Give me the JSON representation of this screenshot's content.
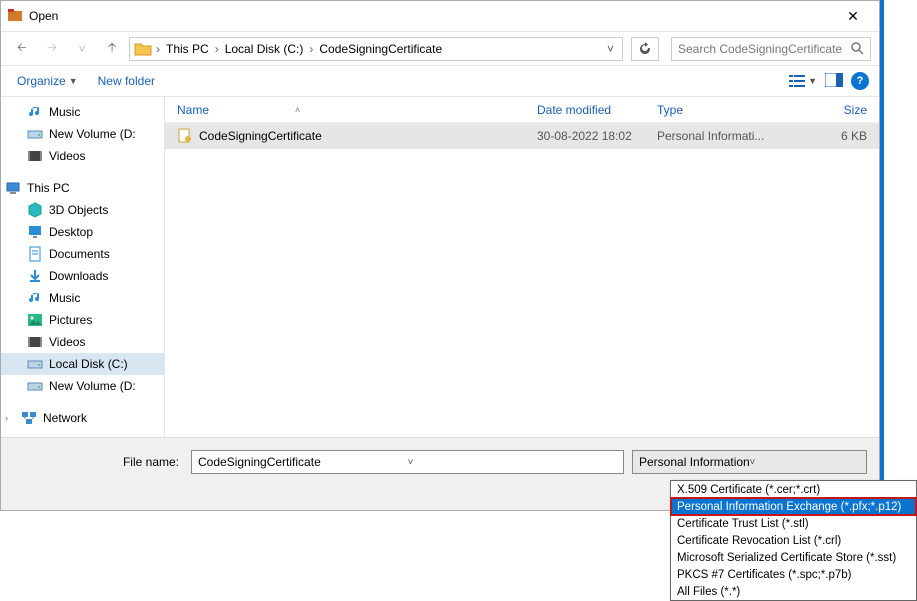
{
  "title": "Open",
  "breadcrumbs": [
    "This PC",
    "Local Disk (C:)",
    "CodeSigningCertificate"
  ],
  "search_placeholder": "Search CodeSigningCertificate",
  "toolbar": {
    "organize": "Organize",
    "new_folder": "New folder"
  },
  "tree": {
    "quick": [
      {
        "label": "Music",
        "icon": "music"
      },
      {
        "label": "New Volume (D:",
        "icon": "drive"
      },
      {
        "label": "Videos",
        "icon": "video"
      }
    ],
    "thispc_label": "This PC",
    "thispc": [
      {
        "label": "3D Objects",
        "icon": "cube"
      },
      {
        "label": "Desktop",
        "icon": "desktop"
      },
      {
        "label": "Documents",
        "icon": "doc"
      },
      {
        "label": "Downloads",
        "icon": "download"
      },
      {
        "label": "Music",
        "icon": "music"
      },
      {
        "label": "Pictures",
        "icon": "picture"
      },
      {
        "label": "Videos",
        "icon": "video"
      },
      {
        "label": "Local Disk (C:)",
        "icon": "drive",
        "selected": true
      },
      {
        "label": "New Volume (D:",
        "icon": "drive"
      }
    ],
    "network_label": "Network"
  },
  "columns": {
    "name": "Name",
    "date": "Date modified",
    "type": "Type",
    "size": "Size"
  },
  "rows": [
    {
      "name": "CodeSigningCertificate",
      "date": "30-08-2022 18:02",
      "type": "Personal Informati...",
      "size": "6 KB"
    }
  ],
  "footer": {
    "filename_label": "File name:",
    "filename_value": "CodeSigningCertificate",
    "filter_selected": "Personal Information Exchange (*.pfx;*.p12)"
  },
  "filter_options": [
    "X.509 Certificate (*.cer;*.crt)",
    "Personal Information Exchange (*.pfx;*.p12)",
    "Certificate Trust List (*.stl)",
    "Certificate Revocation List (*.crl)",
    "Microsoft Serialized Certificate Store (*.sst)",
    "PKCS #7 Certificates (*.spc;*.p7b)",
    "All Files (*.*)"
  ]
}
